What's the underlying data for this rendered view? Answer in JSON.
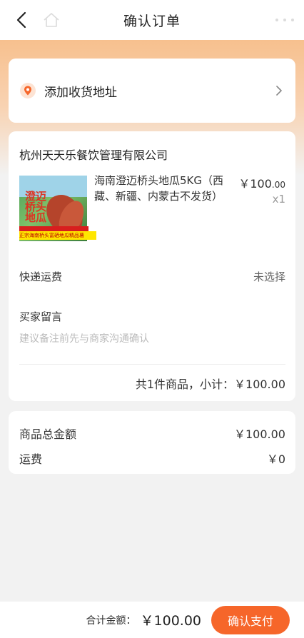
{
  "header": {
    "title": "确认订单"
  },
  "address": {
    "label": "添加收货地址"
  },
  "order": {
    "shop_name": "杭州天天乐餐饮管理有限公司",
    "product": {
      "name": "海南澄迈桥头地瓜5KG（西藏、新疆、内蒙古不发货）",
      "price_symbol": "￥",
      "price_int": "100",
      "price_dec": ".00",
      "quantity": "x1",
      "image_text": "澄迈桥头地瓜",
      "banner_text": "正宗海南桥头富硒地瓜精品薯"
    },
    "shipping": {
      "label": "快递运费",
      "value": "未选择"
    },
    "message": {
      "label": "买家留言",
      "placeholder": "建议备注前先与商家沟通确认"
    },
    "subtotal": "共1件商品，小计：￥100.00"
  },
  "summary": {
    "goods_total_label": "商品总金额",
    "goods_total_value": "￥100.00",
    "freight_label": "运费",
    "freight_value": "￥0"
  },
  "footer": {
    "total_label": "合计金额：",
    "total_value": "￥100.00",
    "pay_label": "确认支付"
  },
  "colors": {
    "accent": "#f6662a",
    "gradient_top": "#f7c08e"
  }
}
